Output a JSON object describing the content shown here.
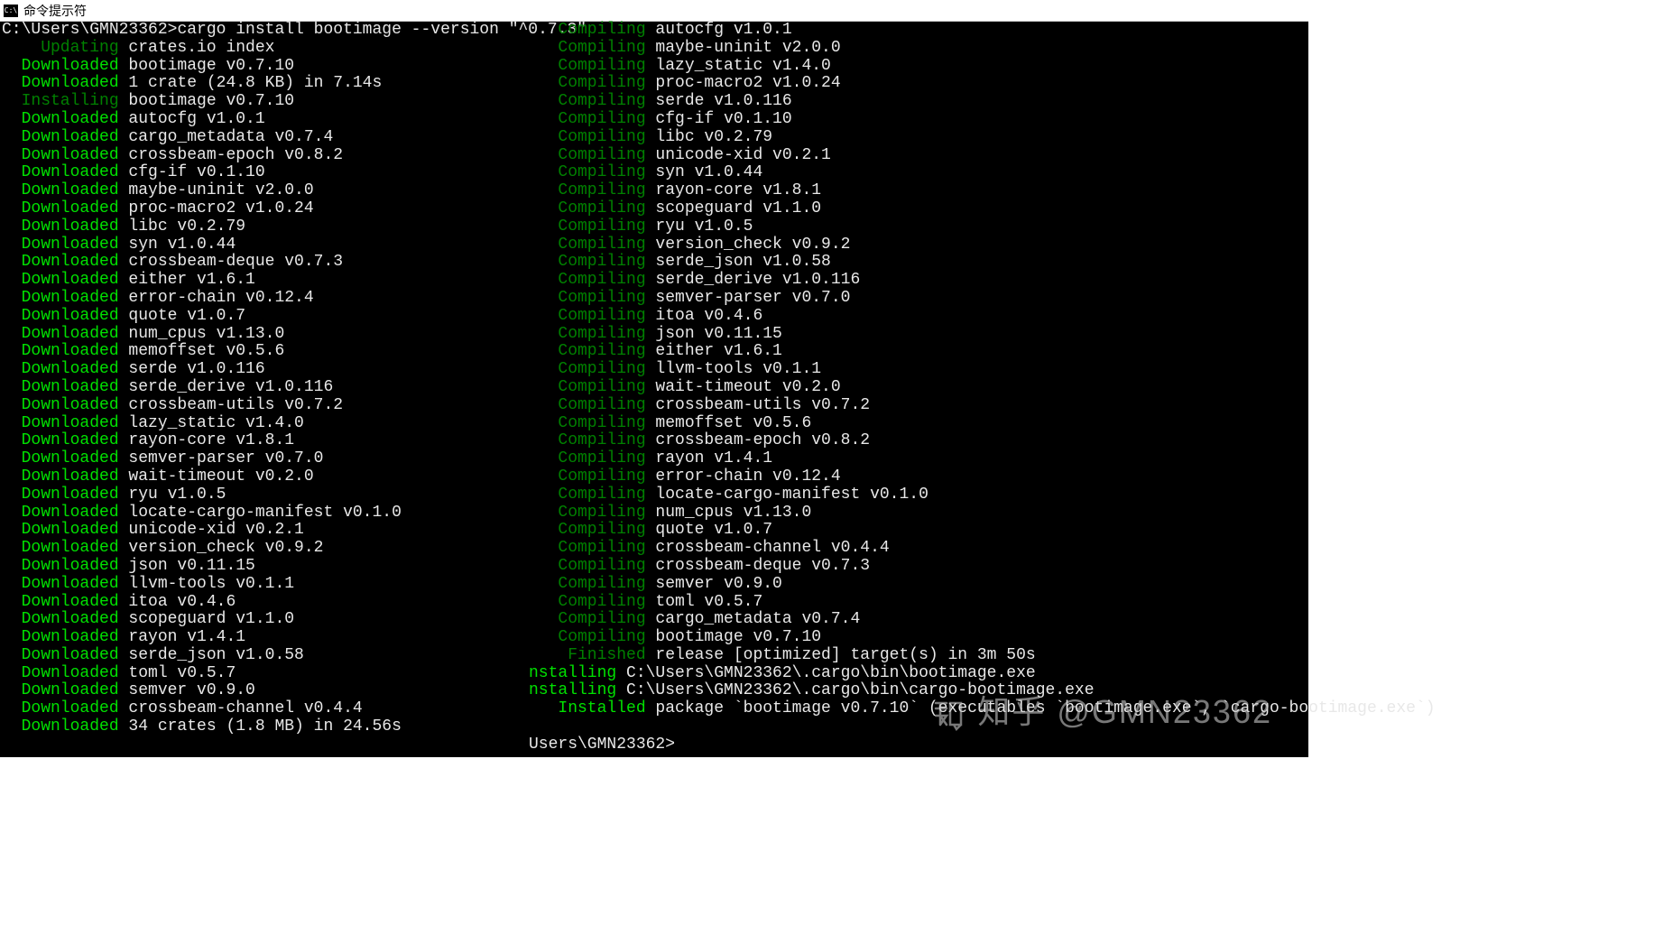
{
  "window": {
    "title": "命令提示符"
  },
  "prompt": {
    "path": "C:\\Users\\GMN23362>",
    "cmd": "cargo install bootimage --version \"^0.7.3\""
  },
  "left": [
    {
      "c": "dgreen",
      "lbl": "Updating",
      "txt": "crates.io index",
      "pad": 4
    },
    {
      "c": "green",
      "lbl": "Downloaded",
      "txt": "bootimage v0.7.10",
      "pad": 2
    },
    {
      "c": "green",
      "lbl": "Downloaded",
      "txt": "1 crate (24.8 KB) in 7.14s",
      "pad": 2
    },
    {
      "c": "dgreen",
      "lbl": "Installing",
      "txt": "bootimage v0.7.10",
      "pad": 2
    },
    {
      "c": "green",
      "lbl": "Downloaded",
      "txt": "autocfg v1.0.1",
      "pad": 2
    },
    {
      "c": "green",
      "lbl": "Downloaded",
      "txt": "cargo_metadata v0.7.4",
      "pad": 2
    },
    {
      "c": "green",
      "lbl": "Downloaded",
      "txt": "crossbeam-epoch v0.8.2",
      "pad": 2
    },
    {
      "c": "green",
      "lbl": "Downloaded",
      "txt": "cfg-if v0.1.10",
      "pad": 2
    },
    {
      "c": "green",
      "lbl": "Downloaded",
      "txt": "maybe-uninit v2.0.0",
      "pad": 2
    },
    {
      "c": "green",
      "lbl": "Downloaded",
      "txt": "proc-macro2 v1.0.24",
      "pad": 2
    },
    {
      "c": "green",
      "lbl": "Downloaded",
      "txt": "libc v0.2.79",
      "pad": 2
    },
    {
      "c": "green",
      "lbl": "Downloaded",
      "txt": "syn v1.0.44",
      "pad": 2
    },
    {
      "c": "green",
      "lbl": "Downloaded",
      "txt": "crossbeam-deque v0.7.3",
      "pad": 2
    },
    {
      "c": "green",
      "lbl": "Downloaded",
      "txt": "either v1.6.1",
      "pad": 2
    },
    {
      "c": "green",
      "lbl": "Downloaded",
      "txt": "error-chain v0.12.4",
      "pad": 2
    },
    {
      "c": "green",
      "lbl": "Downloaded",
      "txt": "quote v1.0.7",
      "pad": 2
    },
    {
      "c": "green",
      "lbl": "Downloaded",
      "txt": "num_cpus v1.13.0",
      "pad": 2
    },
    {
      "c": "green",
      "lbl": "Downloaded",
      "txt": "memoffset v0.5.6",
      "pad": 2
    },
    {
      "c": "green",
      "lbl": "Downloaded",
      "txt": "serde v1.0.116",
      "pad": 2
    },
    {
      "c": "green",
      "lbl": "Downloaded",
      "txt": "serde_derive v1.0.116",
      "pad": 2
    },
    {
      "c": "green",
      "lbl": "Downloaded",
      "txt": "crossbeam-utils v0.7.2",
      "pad": 2
    },
    {
      "c": "green",
      "lbl": "Downloaded",
      "txt": "lazy_static v1.4.0",
      "pad": 2
    },
    {
      "c": "green",
      "lbl": "Downloaded",
      "txt": "rayon-core v1.8.1",
      "pad": 2
    },
    {
      "c": "green",
      "lbl": "Downloaded",
      "txt": "semver-parser v0.7.0",
      "pad": 2
    },
    {
      "c": "green",
      "lbl": "Downloaded",
      "txt": "wait-timeout v0.2.0",
      "pad": 2
    },
    {
      "c": "green",
      "lbl": "Downloaded",
      "txt": "ryu v1.0.5",
      "pad": 2
    },
    {
      "c": "green",
      "lbl": "Downloaded",
      "txt": "locate-cargo-manifest v0.1.0",
      "pad": 2
    },
    {
      "c": "green",
      "lbl": "Downloaded",
      "txt": "unicode-xid v0.2.1",
      "pad": 2
    },
    {
      "c": "green",
      "lbl": "Downloaded",
      "txt": "version_check v0.9.2",
      "pad": 2
    },
    {
      "c": "green",
      "lbl": "Downloaded",
      "txt": "json v0.11.15",
      "pad": 2
    },
    {
      "c": "green",
      "lbl": "Downloaded",
      "txt": "llvm-tools v0.1.1",
      "pad": 2
    },
    {
      "c": "green",
      "lbl": "Downloaded",
      "txt": "itoa v0.4.6",
      "pad": 2
    },
    {
      "c": "green",
      "lbl": "Downloaded",
      "txt": "scopeguard v1.1.0",
      "pad": 2
    },
    {
      "c": "green",
      "lbl": "Downloaded",
      "txt": "rayon v1.4.1",
      "pad": 2
    },
    {
      "c": "green",
      "lbl": "Downloaded",
      "txt": "serde_json v1.0.58",
      "pad": 2
    },
    {
      "c": "green",
      "lbl": "Downloaded",
      "txt": "toml v0.5.7",
      "pad": 2
    },
    {
      "c": "green",
      "lbl": "Downloaded",
      "txt": "semver v0.9.0",
      "pad": 2
    },
    {
      "c": "green",
      "lbl": "Downloaded",
      "txt": "crossbeam-channel v0.4.4",
      "pad": 2
    },
    {
      "c": "green",
      "lbl": "Downloaded",
      "txt": "34 crates (1.8 MB) in 24.56s",
      "pad": 2
    }
  ],
  "right": [
    {
      "c": "dgreen",
      "lbl": "Compiling",
      "txt": "autocfg v1.0.1",
      "pad": 3
    },
    {
      "c": "dgreen",
      "lbl": "Compiling",
      "txt": "maybe-uninit v2.0.0",
      "pad": 3
    },
    {
      "c": "dgreen",
      "lbl": "Compiling",
      "txt": "lazy_static v1.4.0",
      "pad": 3
    },
    {
      "c": "dgreen",
      "lbl": "Compiling",
      "txt": "proc-macro2 v1.0.24",
      "pad": 3
    },
    {
      "c": "dgreen",
      "lbl": "Compiling",
      "txt": "serde v1.0.116",
      "pad": 3
    },
    {
      "c": "dgreen",
      "lbl": "Compiling",
      "txt": "cfg-if v0.1.10",
      "pad": 3
    },
    {
      "c": "dgreen",
      "lbl": "Compiling",
      "txt": "libc v0.2.79",
      "pad": 3
    },
    {
      "c": "dgreen",
      "lbl": "Compiling",
      "txt": "unicode-xid v0.2.1",
      "pad": 3
    },
    {
      "c": "dgreen",
      "lbl": "Compiling",
      "txt": "syn v1.0.44",
      "pad": 3
    },
    {
      "c": "dgreen",
      "lbl": "Compiling",
      "txt": "rayon-core v1.8.1",
      "pad": 3
    },
    {
      "c": "dgreen",
      "lbl": "Compiling",
      "txt": "scopeguard v1.1.0",
      "pad": 3
    },
    {
      "c": "dgreen",
      "lbl": "Compiling",
      "txt": "ryu v1.0.5",
      "pad": 3
    },
    {
      "c": "dgreen",
      "lbl": "Compiling",
      "txt": "version_check v0.9.2",
      "pad": 3
    },
    {
      "c": "dgreen",
      "lbl": "Compiling",
      "txt": "serde_json v1.0.58",
      "pad": 3
    },
    {
      "c": "dgreen",
      "lbl": "Compiling",
      "txt": "serde_derive v1.0.116",
      "pad": 3
    },
    {
      "c": "dgreen",
      "lbl": "Compiling",
      "txt": "semver-parser v0.7.0",
      "pad": 3
    },
    {
      "c": "dgreen",
      "lbl": "Compiling",
      "txt": "itoa v0.4.6",
      "pad": 3
    },
    {
      "c": "dgreen",
      "lbl": "Compiling",
      "txt": "json v0.11.15",
      "pad": 3
    },
    {
      "c": "dgreen",
      "lbl": "Compiling",
      "txt": "either v1.6.1",
      "pad": 3
    },
    {
      "c": "dgreen",
      "lbl": "Compiling",
      "txt": "llvm-tools v0.1.1",
      "pad": 3
    },
    {
      "c": "dgreen",
      "lbl": "Compiling",
      "txt": "wait-timeout v0.2.0",
      "pad": 3
    },
    {
      "c": "dgreen",
      "lbl": "Compiling",
      "txt": "crossbeam-utils v0.7.2",
      "pad": 3
    },
    {
      "c": "dgreen",
      "lbl": "Compiling",
      "txt": "memoffset v0.5.6",
      "pad": 3
    },
    {
      "c": "dgreen",
      "lbl": "Compiling",
      "txt": "crossbeam-epoch v0.8.2",
      "pad": 3
    },
    {
      "c": "dgreen",
      "lbl": "Compiling",
      "txt": "rayon v1.4.1",
      "pad": 3
    },
    {
      "c": "dgreen",
      "lbl": "Compiling",
      "txt": "error-chain v0.12.4",
      "pad": 3
    },
    {
      "c": "dgreen",
      "lbl": "Compiling",
      "txt": "locate-cargo-manifest v0.1.0",
      "pad": 3
    },
    {
      "c": "dgreen",
      "lbl": "Compiling",
      "txt": "num_cpus v1.13.0",
      "pad": 3
    },
    {
      "c": "dgreen",
      "lbl": "Compiling",
      "txt": "quote v1.0.7",
      "pad": 3
    },
    {
      "c": "dgreen",
      "lbl": "Compiling",
      "txt": "crossbeam-channel v0.4.4",
      "pad": 3
    },
    {
      "c": "dgreen",
      "lbl": "Compiling",
      "txt": "crossbeam-deque v0.7.3",
      "pad": 3
    },
    {
      "c": "dgreen",
      "lbl": "Compiling",
      "txt": "semver v0.9.0",
      "pad": 3
    },
    {
      "c": "dgreen",
      "lbl": "Compiling",
      "txt": "toml v0.5.7",
      "pad": 3
    },
    {
      "c": "dgreen",
      "lbl": "Compiling",
      "txt": "cargo_metadata v0.7.4",
      "pad": 3
    },
    {
      "c": "dgreen",
      "lbl": "Compiling",
      "txt": "bootimage v0.7.10",
      "pad": 3
    },
    {
      "c": "dgreen",
      "lbl": "Finished",
      "txt": "release [optimized] target(s) in 3m 50s",
      "pad": 4
    },
    {
      "c": "green",
      "lbl": "nstalling",
      "txt": "C:\\Users\\GMN23362\\.cargo\\bin\\bootimage.exe",
      "pad": 0
    },
    {
      "c": "green",
      "lbl": "nstalling",
      "txt": "C:\\Users\\GMN23362\\.cargo\\bin\\cargo-bootimage.exe",
      "pad": 0
    },
    {
      "c": "green",
      "lbl": "Installed",
      "txt": "package `bootimage v0.7.10` (executables `bootimage.exe`, `cargo-bootimage.exe`)",
      "pad": 3
    }
  ],
  "right_tail": {
    "blank": "",
    "prompt2": "Users\\GMN23362>"
  },
  "watermark": "知乎 @GMN23362"
}
